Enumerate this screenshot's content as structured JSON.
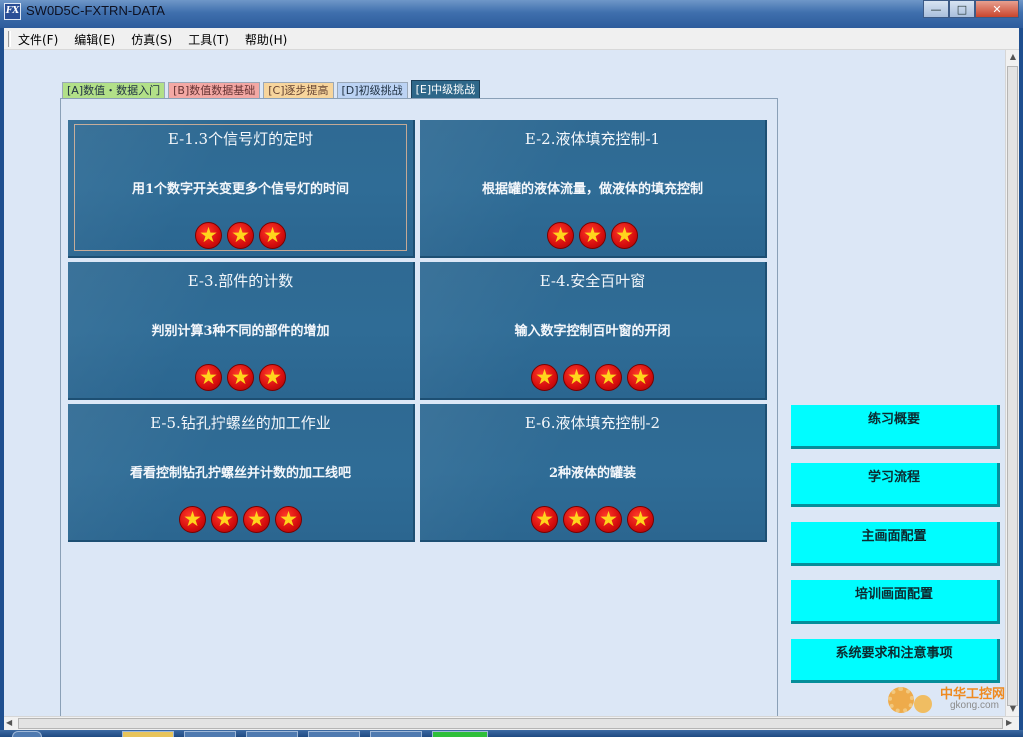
{
  "window": {
    "title": "SW0D5C-FXTRN-DATA",
    "icon_text": "FX"
  },
  "menu": {
    "items": [
      {
        "label": "文件(F)"
      },
      {
        "label": "编辑(E)"
      },
      {
        "label": "仿真(S)"
      },
      {
        "label": "工具(T)"
      },
      {
        "label": "帮助(H)"
      }
    ]
  },
  "tabs": [
    {
      "label": "[A]数值・数据入门",
      "color": "#b2e088"
    },
    {
      "label": "[B]数值数据基础",
      "color": "#f3a8a4"
    },
    {
      "label": "[C]逐步提高",
      "color": "#f7d59c"
    },
    {
      "label": "[D]初级挑战",
      "color": "#bcd3f4"
    },
    {
      "label": "[E]中级挑战",
      "color": "#2e6789",
      "active": true
    }
  ],
  "exercises": [
    {
      "title": "E-1.3个信号灯的定时",
      "description": "用1个数字开关变更多个信号灯的时间",
      "stars": 3,
      "selected": true
    },
    {
      "title": "E-2.液体填充控制-1",
      "description": "根据罐的液体流量，做液体的填充控制",
      "stars": 3
    },
    {
      "title": "E-3.部件的计数",
      "description": "判别计算3种不同的部件的增加",
      "stars": 3
    },
    {
      "title": "E-4.安全百叶窗",
      "description": "输入数字控制百叶窗的开闭",
      "stars": 4
    },
    {
      "title": "E-5.钻孔拧螺丝的加工作业",
      "description": "看看控制钻孔拧螺丝并计数的加工线吧",
      "stars": 4
    },
    {
      "title": "E-6.液体填充控制-2",
      "description": "2种液体的罐装",
      "stars": 4
    }
  ],
  "side_buttons": [
    {
      "label": "练习概要"
    },
    {
      "label": "学习流程"
    },
    {
      "label": "主画面配置"
    },
    {
      "label": "培训画面配置"
    },
    {
      "label": "系统要求和注意事项"
    }
  ],
  "colors": {
    "card_bg": "#2f6a93",
    "side_button_bg": "#00fdff",
    "client_bg": "#dce7f6",
    "star_fill": "#d50d0d",
    "star_glyph": "#ffd51c"
  },
  "watermark": {
    "cn": "中华工控网",
    "url": "gkong.com"
  }
}
